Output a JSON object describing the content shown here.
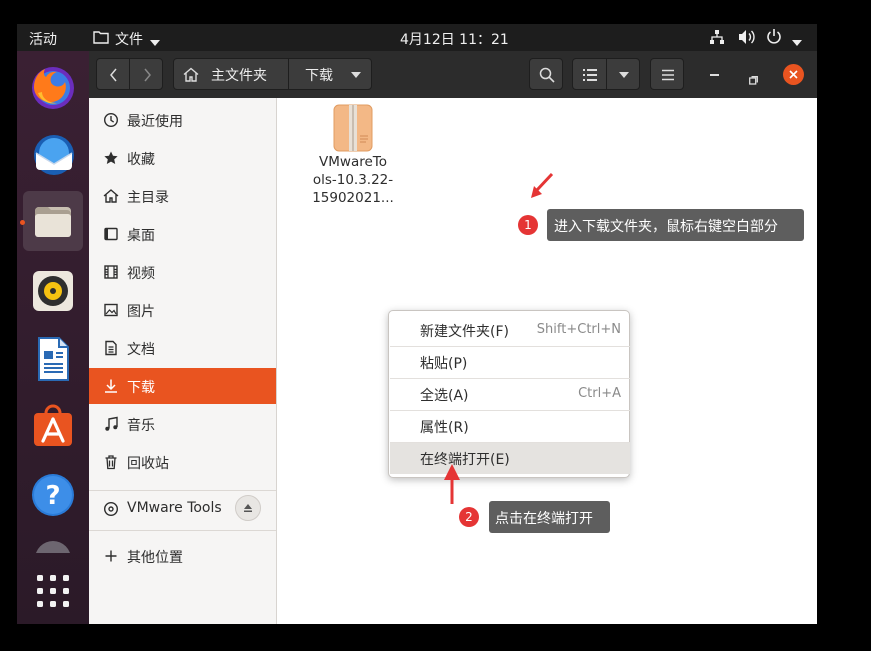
{
  "topbar": {
    "activities": "活动",
    "app_menu": "文件",
    "clock": "4月12日  11：21"
  },
  "header": {
    "home_label": "主文件夹",
    "current_folder": "下载"
  },
  "sidebar": {
    "items": [
      {
        "label": "最近使用",
        "icon": "clock-icon"
      },
      {
        "label": "收藏",
        "icon": "star-icon"
      },
      {
        "label": "主目录",
        "icon": "home-icon"
      },
      {
        "label": "桌面",
        "icon": "desktop-icon"
      },
      {
        "label": "视频",
        "icon": "video-icon"
      },
      {
        "label": "图片",
        "icon": "picture-icon"
      },
      {
        "label": "文档",
        "icon": "document-icon"
      },
      {
        "label": "下载",
        "icon": "download-icon"
      },
      {
        "label": "音乐",
        "icon": "music-icon"
      },
      {
        "label": "回收站",
        "icon": "trash-icon"
      }
    ],
    "device": "VMware Tools",
    "other": "其他位置"
  },
  "file": {
    "name_line1": "VMwareTo",
    "name_line2": "ols-10.3.22-",
    "name_line3": "15902021..."
  },
  "context_menu": {
    "new_folder": "新建文件夹(F)",
    "new_folder_shortcut": "Shift+Ctrl+N",
    "paste": "粘贴(P)",
    "select_all": "全选(A)",
    "select_all_shortcut": "Ctrl+A",
    "properties": "属性(R)",
    "open_terminal": "在终端打开(E)"
  },
  "annotations": {
    "step1_num": "1",
    "step1_text": "进入下载文件夹，鼠标右键空白部分",
    "step2_num": "2",
    "step2_text": "点击在终端打开"
  },
  "colors": {
    "accent": "#e95420",
    "badge": "#e53535",
    "callout_bg": "#5e5e5e"
  }
}
